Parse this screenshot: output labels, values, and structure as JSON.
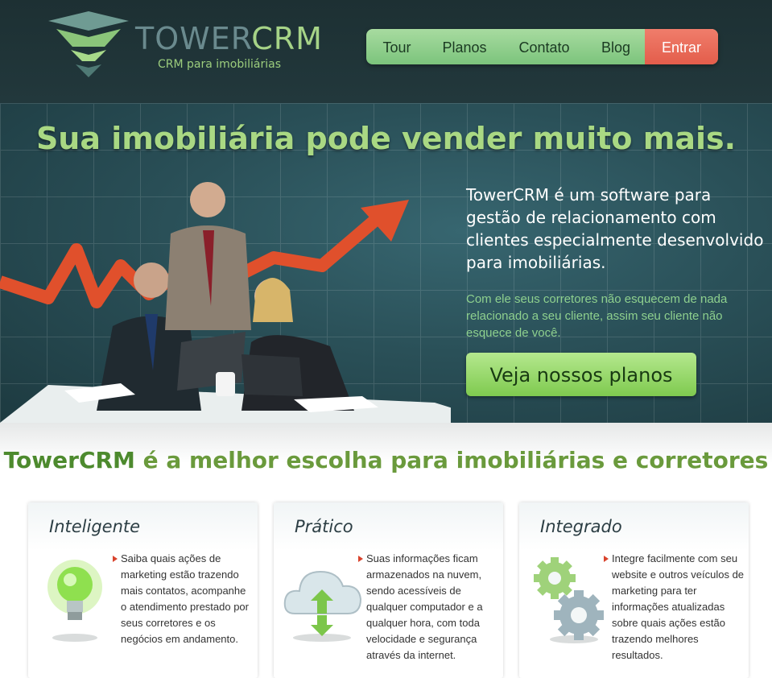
{
  "brand": {
    "name_part1": "TOWER",
    "name_part2": "CRM",
    "tagline": "CRM para imobiliárias"
  },
  "nav": {
    "items": [
      "Tour",
      "Planos",
      "Contato",
      "Blog"
    ],
    "login_label": "Entrar"
  },
  "hero": {
    "title": "Sua imobiliária pode vender muito mais.",
    "lead": "TowerCRM é um software para gestão de relacionamento com clientes especialmente desenvolvido para imobiliárias.",
    "sub": "Com ele seus corretores não esquecem de nada relacionado a seu cliente, assim seu cliente não esquece de você.",
    "cta_label": "Veja nossos planos"
  },
  "section": {
    "title_brand": "TowerCRM",
    "title_rest": " é a melhor escolha para imobiliárias e corretores"
  },
  "features": [
    {
      "title": "Inteligente",
      "icon": "light-bulb-icon",
      "text": "Saiba quais ações de marketing estão trazendo mais contatos, acompanhe o atendimento prestado por seus corretores e os negócios em andamento."
    },
    {
      "title": "Prático",
      "icon": "cloud-sync-icon",
      "text": "Suas informações ficam armazenados na nuvem, sendo acessíveis de qualquer computador e a qualquer hora, com toda velocidade e segurança através da internet."
    },
    {
      "title": "Integrado",
      "icon": "gears-icon",
      "text": "Integre facilmente com seu website e outros veículos de marketing para ter informações atualizadas sobre quais ações estão trazendo melhores resultados."
    }
  ],
  "colors": {
    "header_bg": "#1d3033",
    "nav_green": "#7cc47c",
    "login_red": "#e35d4b",
    "accent_green": "#a9d883",
    "section_green": "#6a9a3c"
  }
}
